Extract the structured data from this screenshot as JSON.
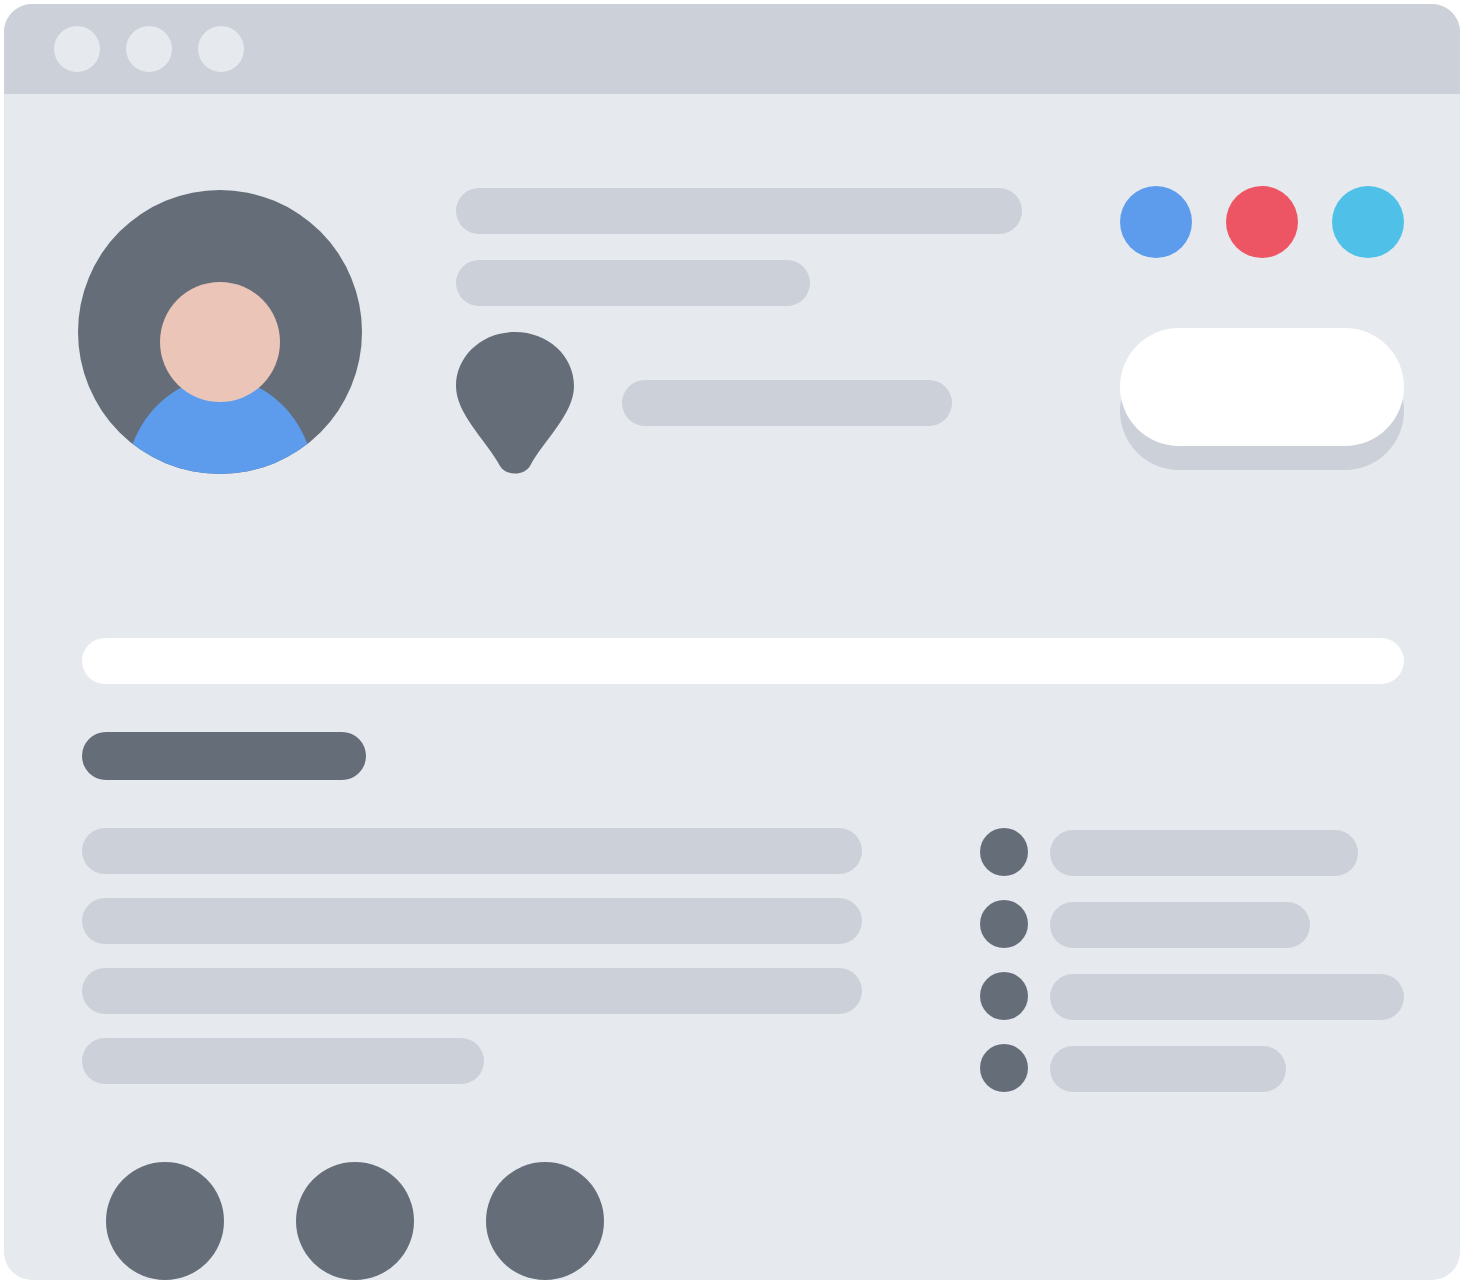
{
  "color_dots": [
    {
      "color": "#5d9cec"
    },
    {
      "color": "#ed5565"
    },
    {
      "color": "#4fc1e9"
    }
  ]
}
